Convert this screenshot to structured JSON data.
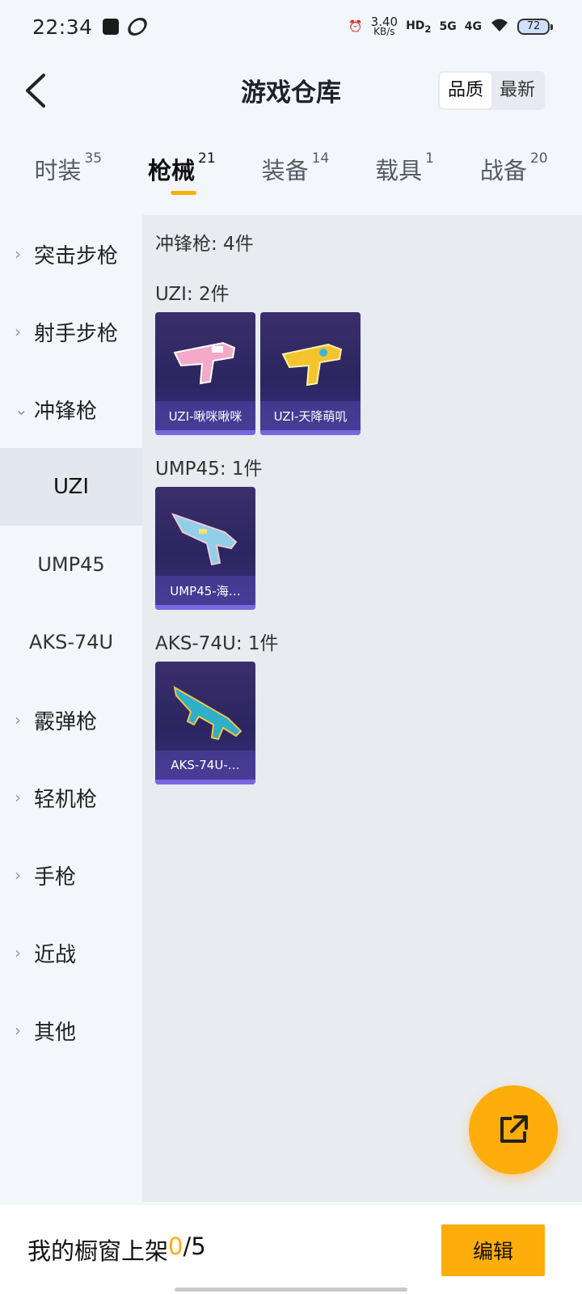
{
  "status_bar": {
    "time": "22:34",
    "net_speed_value": "3.40",
    "net_speed_unit": "KB/s",
    "hd_label": "HD",
    "hd_sub": "2",
    "sig1_label": "5G",
    "sig2_label": "4G",
    "battery": "72"
  },
  "header": {
    "title": "游戏仓库",
    "sort_options": [
      "品质",
      "最新"
    ]
  },
  "tabs": [
    {
      "label": "时装",
      "count": "35"
    },
    {
      "label": "枪械",
      "count": "21"
    },
    {
      "label": "装备",
      "count": "14"
    },
    {
      "label": "载具",
      "count": "1"
    },
    {
      "label": "战备",
      "count": "20"
    }
  ],
  "sidebar": {
    "items": [
      {
        "label": "突击步枪"
      },
      {
        "label": "射手步枪"
      },
      {
        "label": "冲锋枪"
      },
      {
        "label": "霰弹枪"
      },
      {
        "label": "轻机枪"
      },
      {
        "label": "手枪"
      },
      {
        "label": "近战"
      },
      {
        "label": "其他"
      }
    ],
    "sub_items": [
      "UZI",
      "UMP45",
      "AKS-74U"
    ]
  },
  "content": {
    "category_header": "冲锋枪: 4件",
    "groups": [
      {
        "header": "UZI: 2件",
        "items": [
          {
            "name": "UZI-啾咪啾咪",
            "color": "#f4a9c8"
          },
          {
            "name": "UZI-天降萌叽",
            "color": "#f5c32c"
          }
        ]
      },
      {
        "header": "UMP45: 1件",
        "items": [
          {
            "name": "UMP45-海…",
            "color": "#8fd0e8"
          }
        ]
      },
      {
        "header": "AKS-74U: 1件",
        "items": [
          {
            "name": "AKS-74U-…",
            "color": "#2fb0c8"
          }
        ]
      }
    ]
  },
  "bottom_bar": {
    "showcase_prefix": "我的橱窗上架",
    "showcase_count": "0",
    "showcase_total": "/5",
    "edit_label": "编辑"
  },
  "colors": {
    "accent": "#ffad0a",
    "card_bg": "#2b2560"
  }
}
